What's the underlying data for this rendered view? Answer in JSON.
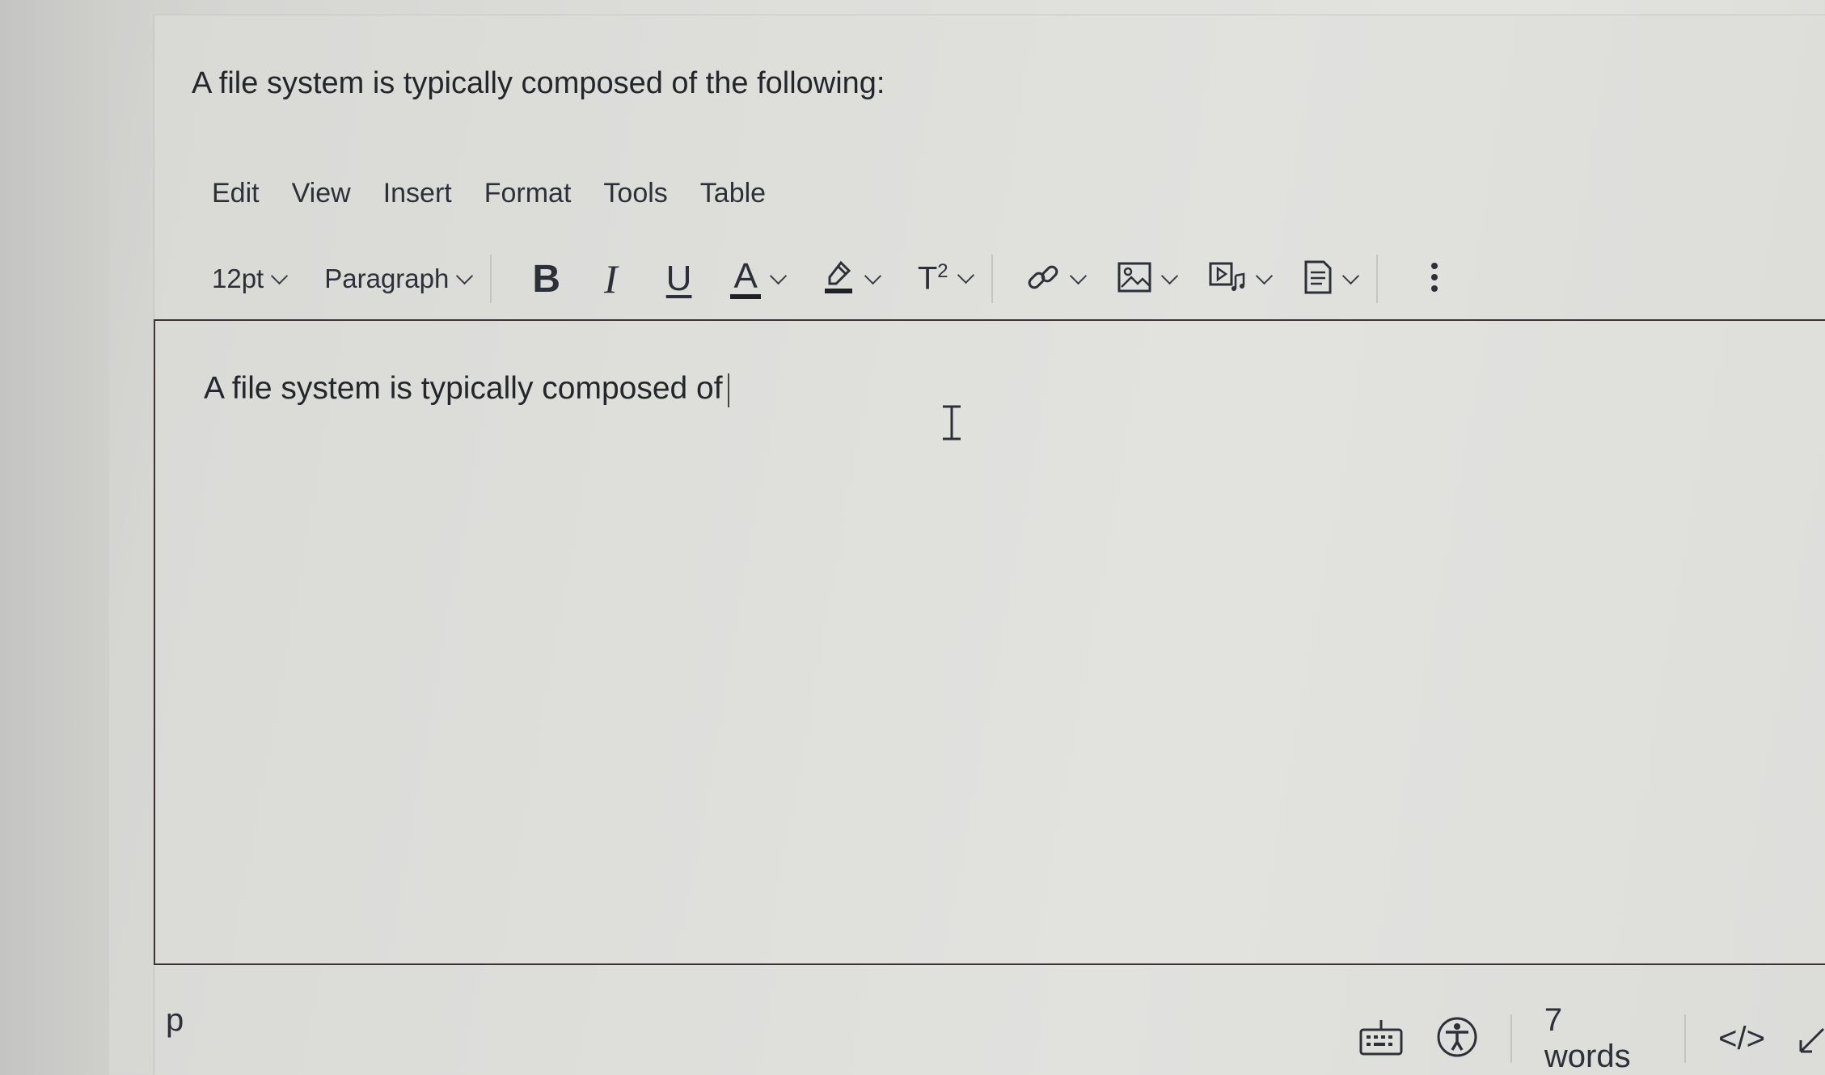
{
  "question": {
    "text": "A file system is typically composed of the following:"
  },
  "menubar": {
    "items": [
      "Edit",
      "View",
      "Insert",
      "Format",
      "Tools",
      "Table"
    ]
  },
  "toolbar": {
    "font_size": "12pt",
    "block_format": "Paragraph",
    "bold_glyph": "B",
    "italic_glyph": "I",
    "underline_glyph": "U",
    "text_color_glyph": "A",
    "superscript_glyph": "T",
    "superscript_exp": "2",
    "icons": [
      "chevron-down-icon",
      "highlighter-icon",
      "link-icon",
      "image-icon",
      "media-icon",
      "document-icon",
      "more-vertical-icon"
    ]
  },
  "editor": {
    "content": "A file system is typically composed of"
  },
  "statusbar": {
    "path": "p",
    "word_count": "7 words",
    "html_toggle": "</>"
  }
}
